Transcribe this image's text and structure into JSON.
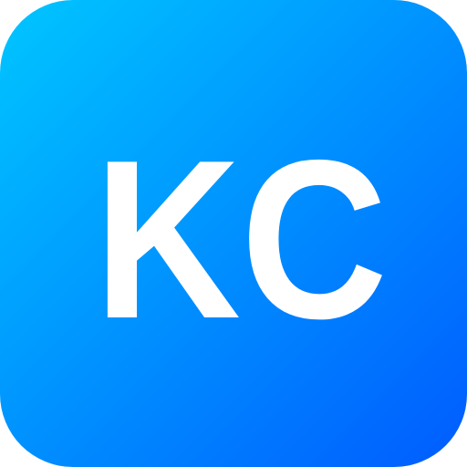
{
  "icon": {
    "monogram": "KC",
    "colors": {
      "gradient_start": "#00C6FF",
      "gradient_mid": "#0096FF",
      "gradient_end": "#005BFF",
      "text": "#FFFFFF"
    }
  }
}
